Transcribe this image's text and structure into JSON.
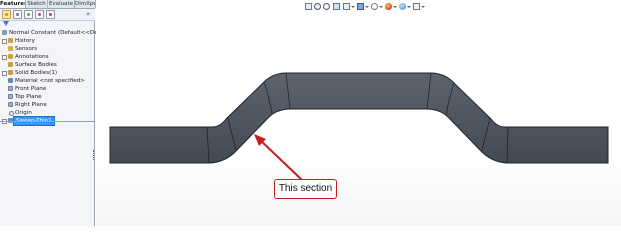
{
  "tabs": [
    {
      "label": "Features",
      "active": true
    },
    {
      "label": "Sketch",
      "active": false
    },
    {
      "label": "Evaluate",
      "active": false
    },
    {
      "label": "DimXpert",
      "active": false
    }
  ],
  "panel_toolbar": {
    "icons": [
      "feature-manager-icon",
      "property-manager-icon",
      "configuration-manager-icon",
      "dimxpert-manager-icon",
      "display-manager-icon"
    ],
    "more": "»"
  },
  "tree": {
    "root": "Normal Constant  (Default<<Default",
    "items": [
      {
        "label": "History",
        "icon": "history-icon",
        "expandable": true,
        "selected": false
      },
      {
        "label": "Sensors",
        "icon": "sensors-icon",
        "expandable": false,
        "selected": false
      },
      {
        "label": "Annotations",
        "icon": "annotations-icon",
        "expandable": true,
        "selected": false
      },
      {
        "label": "Surface Bodies",
        "icon": "surface-bodies-icon",
        "expandable": false,
        "selected": false
      },
      {
        "label": "Solid Bodies(1)",
        "icon": "solid-bodies-icon",
        "expandable": true,
        "selected": false
      },
      {
        "label": "Material <not specified>",
        "icon": "material-icon",
        "expandable": false,
        "selected": false
      },
      {
        "label": "Front Plane",
        "icon": "plane-icon",
        "expandable": false,
        "selected": false
      },
      {
        "label": "Top Plane",
        "icon": "plane-icon",
        "expandable": false,
        "selected": false
      },
      {
        "label": "Right Plane",
        "icon": "plane-icon",
        "expandable": false,
        "selected": false
      },
      {
        "label": "Origin",
        "icon": "origin-icon",
        "expandable": false,
        "selected": false
      },
      {
        "label": "Sweep-Thin1",
        "icon": "sweep-icon",
        "expandable": true,
        "selected": true
      }
    ]
  },
  "heads_up_toolbar": {
    "icons": [
      "zoom-to-fit-icon",
      "zoom-to-area-icon",
      "previous-view-icon",
      "section-view-icon",
      "view-orientation-icon",
      "display-style-icon",
      "hide-show-items-icon",
      "edit-appearance-icon",
      "apply-scene-icon",
      "view-settings-icon"
    ]
  },
  "colors": {
    "part_face": "#4f5662",
    "part_edge": "#1f242b",
    "callout_red": "#c71c1c",
    "selection_blue": "#3399ff"
  },
  "callout": {
    "text": "This section"
  }
}
